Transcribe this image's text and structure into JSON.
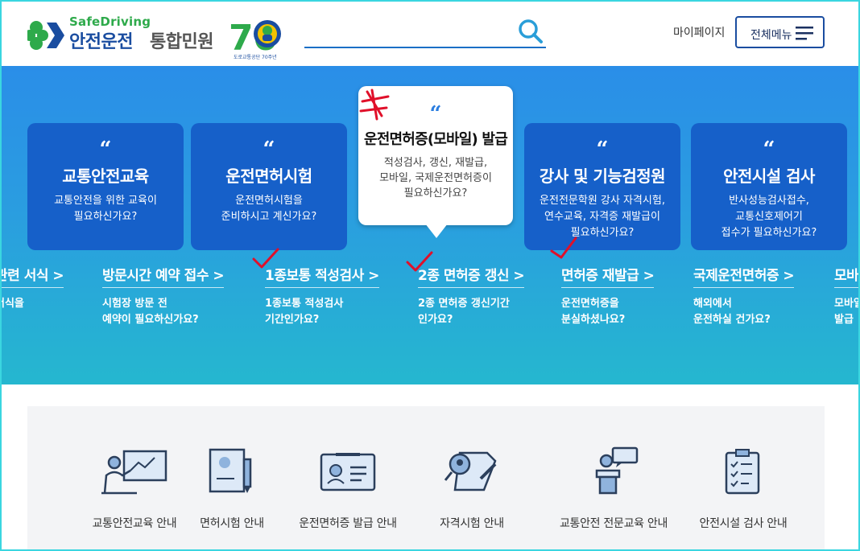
{
  "header": {
    "logo_en": "SafeDriving",
    "logo_ko": "안전운전",
    "logo_title": "통합민원",
    "anniversary_mark": "70",
    "anniversary_caption": "도로교통공단 70주년",
    "search_placeholder": "",
    "mypage_label": "마이페이지",
    "menu_label": "전체메뉴"
  },
  "hero": {
    "cards": [
      {
        "title": "교통안전교육",
        "desc": "교통안전을 위한 교육이\n필요하신가요?"
      },
      {
        "title": "운전면허시험",
        "desc": "운전면허시험을\n준비하시고 계신가요?"
      },
      {
        "title": "운전면허증(모바일) 발급",
        "desc": "적성검사, 갱신, 재발급,\n모바일, 국제운전면허증이\n필요하신가요?"
      },
      {
        "title": "강사 및 기능검정원",
        "desc": "운전전문학원 강사 자격시험,\n연수교육, 자격증 재발급이\n필요하신가요?"
      },
      {
        "title": "안전시설 검사",
        "desc": "반사성능검사접수,\n교통신호제어기\n접수가 필요하신가요?"
      }
    ],
    "quote_mark": "“",
    "quick_links": [
      {
        "title": "관련 서식 >",
        "desc": "서식을"
      },
      {
        "title": "방문시간 예약 접수 >",
        "desc": "시험장 방문 전\n예약이 필요하신가요?"
      },
      {
        "title": "1종보통 적성검사 >",
        "desc": "1종보통 적성검사\n기간인가요?"
      },
      {
        "title": "2종 면허증 갱신 >",
        "desc": "2종 면허증 갱신기간\n인가요?"
      },
      {
        "title": "면허증 재발급 >",
        "desc": "운전면허증을\n분실하셨나요?"
      },
      {
        "title": "국제운전면허증 >",
        "desc": "해외에서\n운전하실 건가요?"
      },
      {
        "title": "모바",
        "desc": "모바일\n발급"
      }
    ]
  },
  "services": [
    {
      "label": "교통안전교육 안내",
      "icon": "presentation-board-icon"
    },
    {
      "label": "면허시험 안내",
      "icon": "document-pen-icon"
    },
    {
      "label": "운전면허증 발급 안내",
      "icon": "id-card-icon"
    },
    {
      "label": "자격시험 안내",
      "icon": "certificate-search-icon"
    },
    {
      "label": "교통안전 전문교육 안내",
      "icon": "lecturer-podium-icon"
    },
    {
      "label": "안전시설 검사 안내",
      "icon": "checklist-clipboard-icon"
    }
  ],
  "colors": {
    "brand_blue": "#1a4da0",
    "brand_green": "#2eaa4b",
    "card_blue": "#1660c9",
    "annotation_red": "#e0102a"
  }
}
